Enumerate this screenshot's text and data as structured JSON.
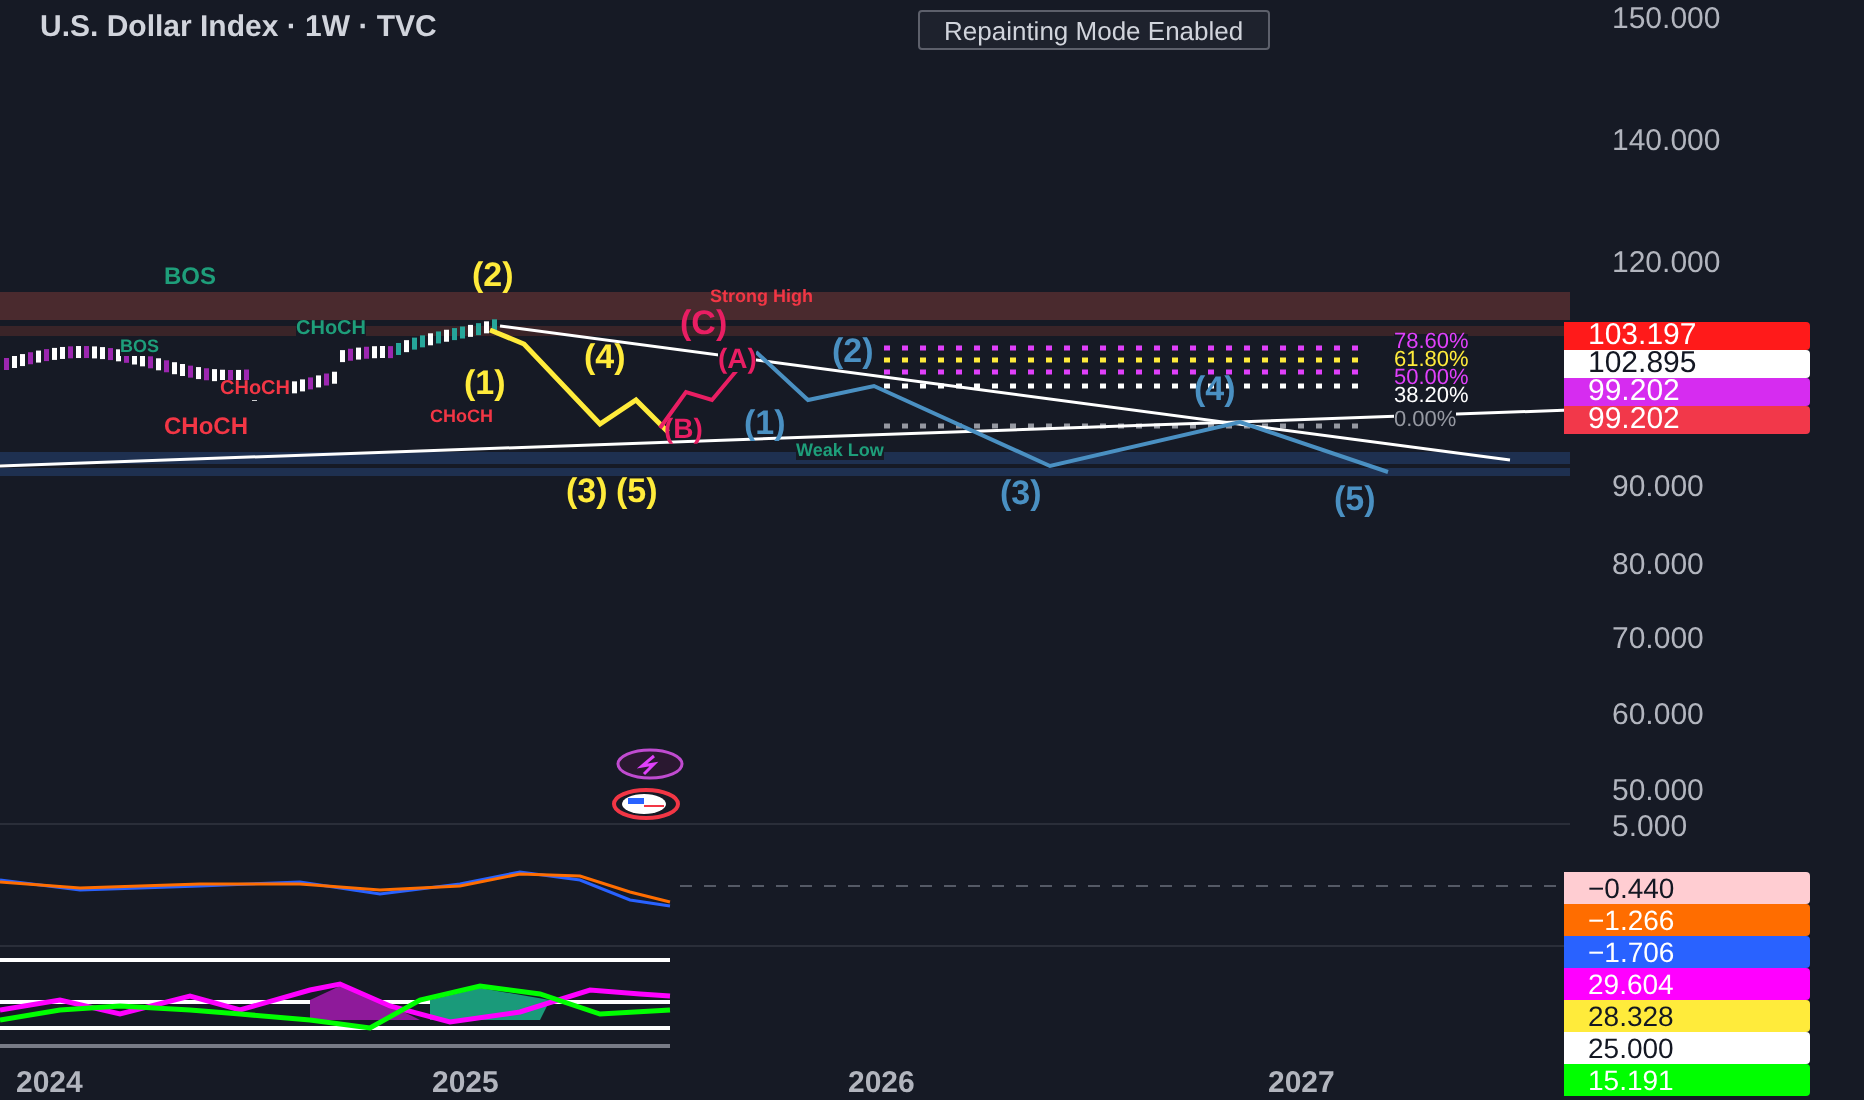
{
  "title": "U.S. Dollar Index · 1W · TVC",
  "mode_badge": "Repainting Mode Enabled",
  "price_axis": [
    "150.000",
    "140.000",
    "120.000",
    "90.000",
    "80.000",
    "70.000",
    "60.000",
    "50.000",
    "5.000"
  ],
  "price_tags": [
    {
      "text": "103.197",
      "color": "#ff1a1a"
    },
    {
      "text": "102.895",
      "color": "#ffffff"
    },
    {
      "text": "99.202",
      "color": "#d62cf0"
    },
    {
      "text": "99.202",
      "color": "#f2384a"
    }
  ],
  "structure_labels": [
    {
      "text": "BOS",
      "color": "#1e9e7a"
    },
    {
      "text": "CHoCH",
      "color": "#1e9e7a"
    },
    {
      "text": "BOS",
      "color": "#1e9e7a"
    },
    {
      "text": "CHoCH",
      "color": "#f23645"
    },
    {
      "text": "CHoCH",
      "color": "#f23645"
    },
    {
      "text": "CHoCH",
      "color": "#f23645"
    },
    {
      "text": "Strong High",
      "color": "#f23645"
    },
    {
      "text": "Weak Low",
      "color": "#1e9e7a"
    }
  ],
  "wave_labels": [
    {
      "text": "(2)",
      "color": "#ffeb3b"
    },
    {
      "text": "(1)",
      "color": "#ffeb3b"
    },
    {
      "text": "(4)",
      "color": "#ffeb3b"
    },
    {
      "text": "(3)",
      "color": "#ffeb3b"
    },
    {
      "text": "(5)",
      "color": "#ffeb3b"
    },
    {
      "text": "(C)",
      "color": "#e91e63"
    },
    {
      "text": "(A)",
      "color": "#e91e63"
    },
    {
      "text": "(B)",
      "color": "#e91e63"
    },
    {
      "text": "(1)",
      "color": "#4a90c2"
    },
    {
      "text": "(2)",
      "color": "#4a90c2"
    },
    {
      "text": "(3)",
      "color": "#4a90c2"
    },
    {
      "text": "(4)",
      "color": "#4a90c2"
    },
    {
      "text": "(5)",
      "color": "#4a90c2"
    }
  ],
  "fib_levels": [
    {
      "text": "78.60%",
      "color": "#e040fb"
    },
    {
      "text": "61.80%",
      "color": "#ffeb3b"
    },
    {
      "text": "50.00%",
      "color": "#e040fb"
    },
    {
      "text": "38.20%",
      "color": "#ffffff"
    },
    {
      "text": "0.00%",
      "color": "#9598a1"
    }
  ],
  "indicator_tags": [
    {
      "text": "−0.440",
      "color": "#ffcdd2"
    },
    {
      "text": "−1.266",
      "color": "#ff6d00"
    },
    {
      "text": "−1.706",
      "color": "#2962ff"
    },
    {
      "text": "29.604",
      "color": "#ff00ff"
    },
    {
      "text": "28.328",
      "color": "#ffeb3b"
    },
    {
      "text": "25.000",
      "color": "#ffffff"
    },
    {
      "text": "15.191",
      "color": "#00ff00"
    }
  ],
  "time_axis": [
    "2024",
    "2025",
    "2026",
    "2027"
  ]
}
